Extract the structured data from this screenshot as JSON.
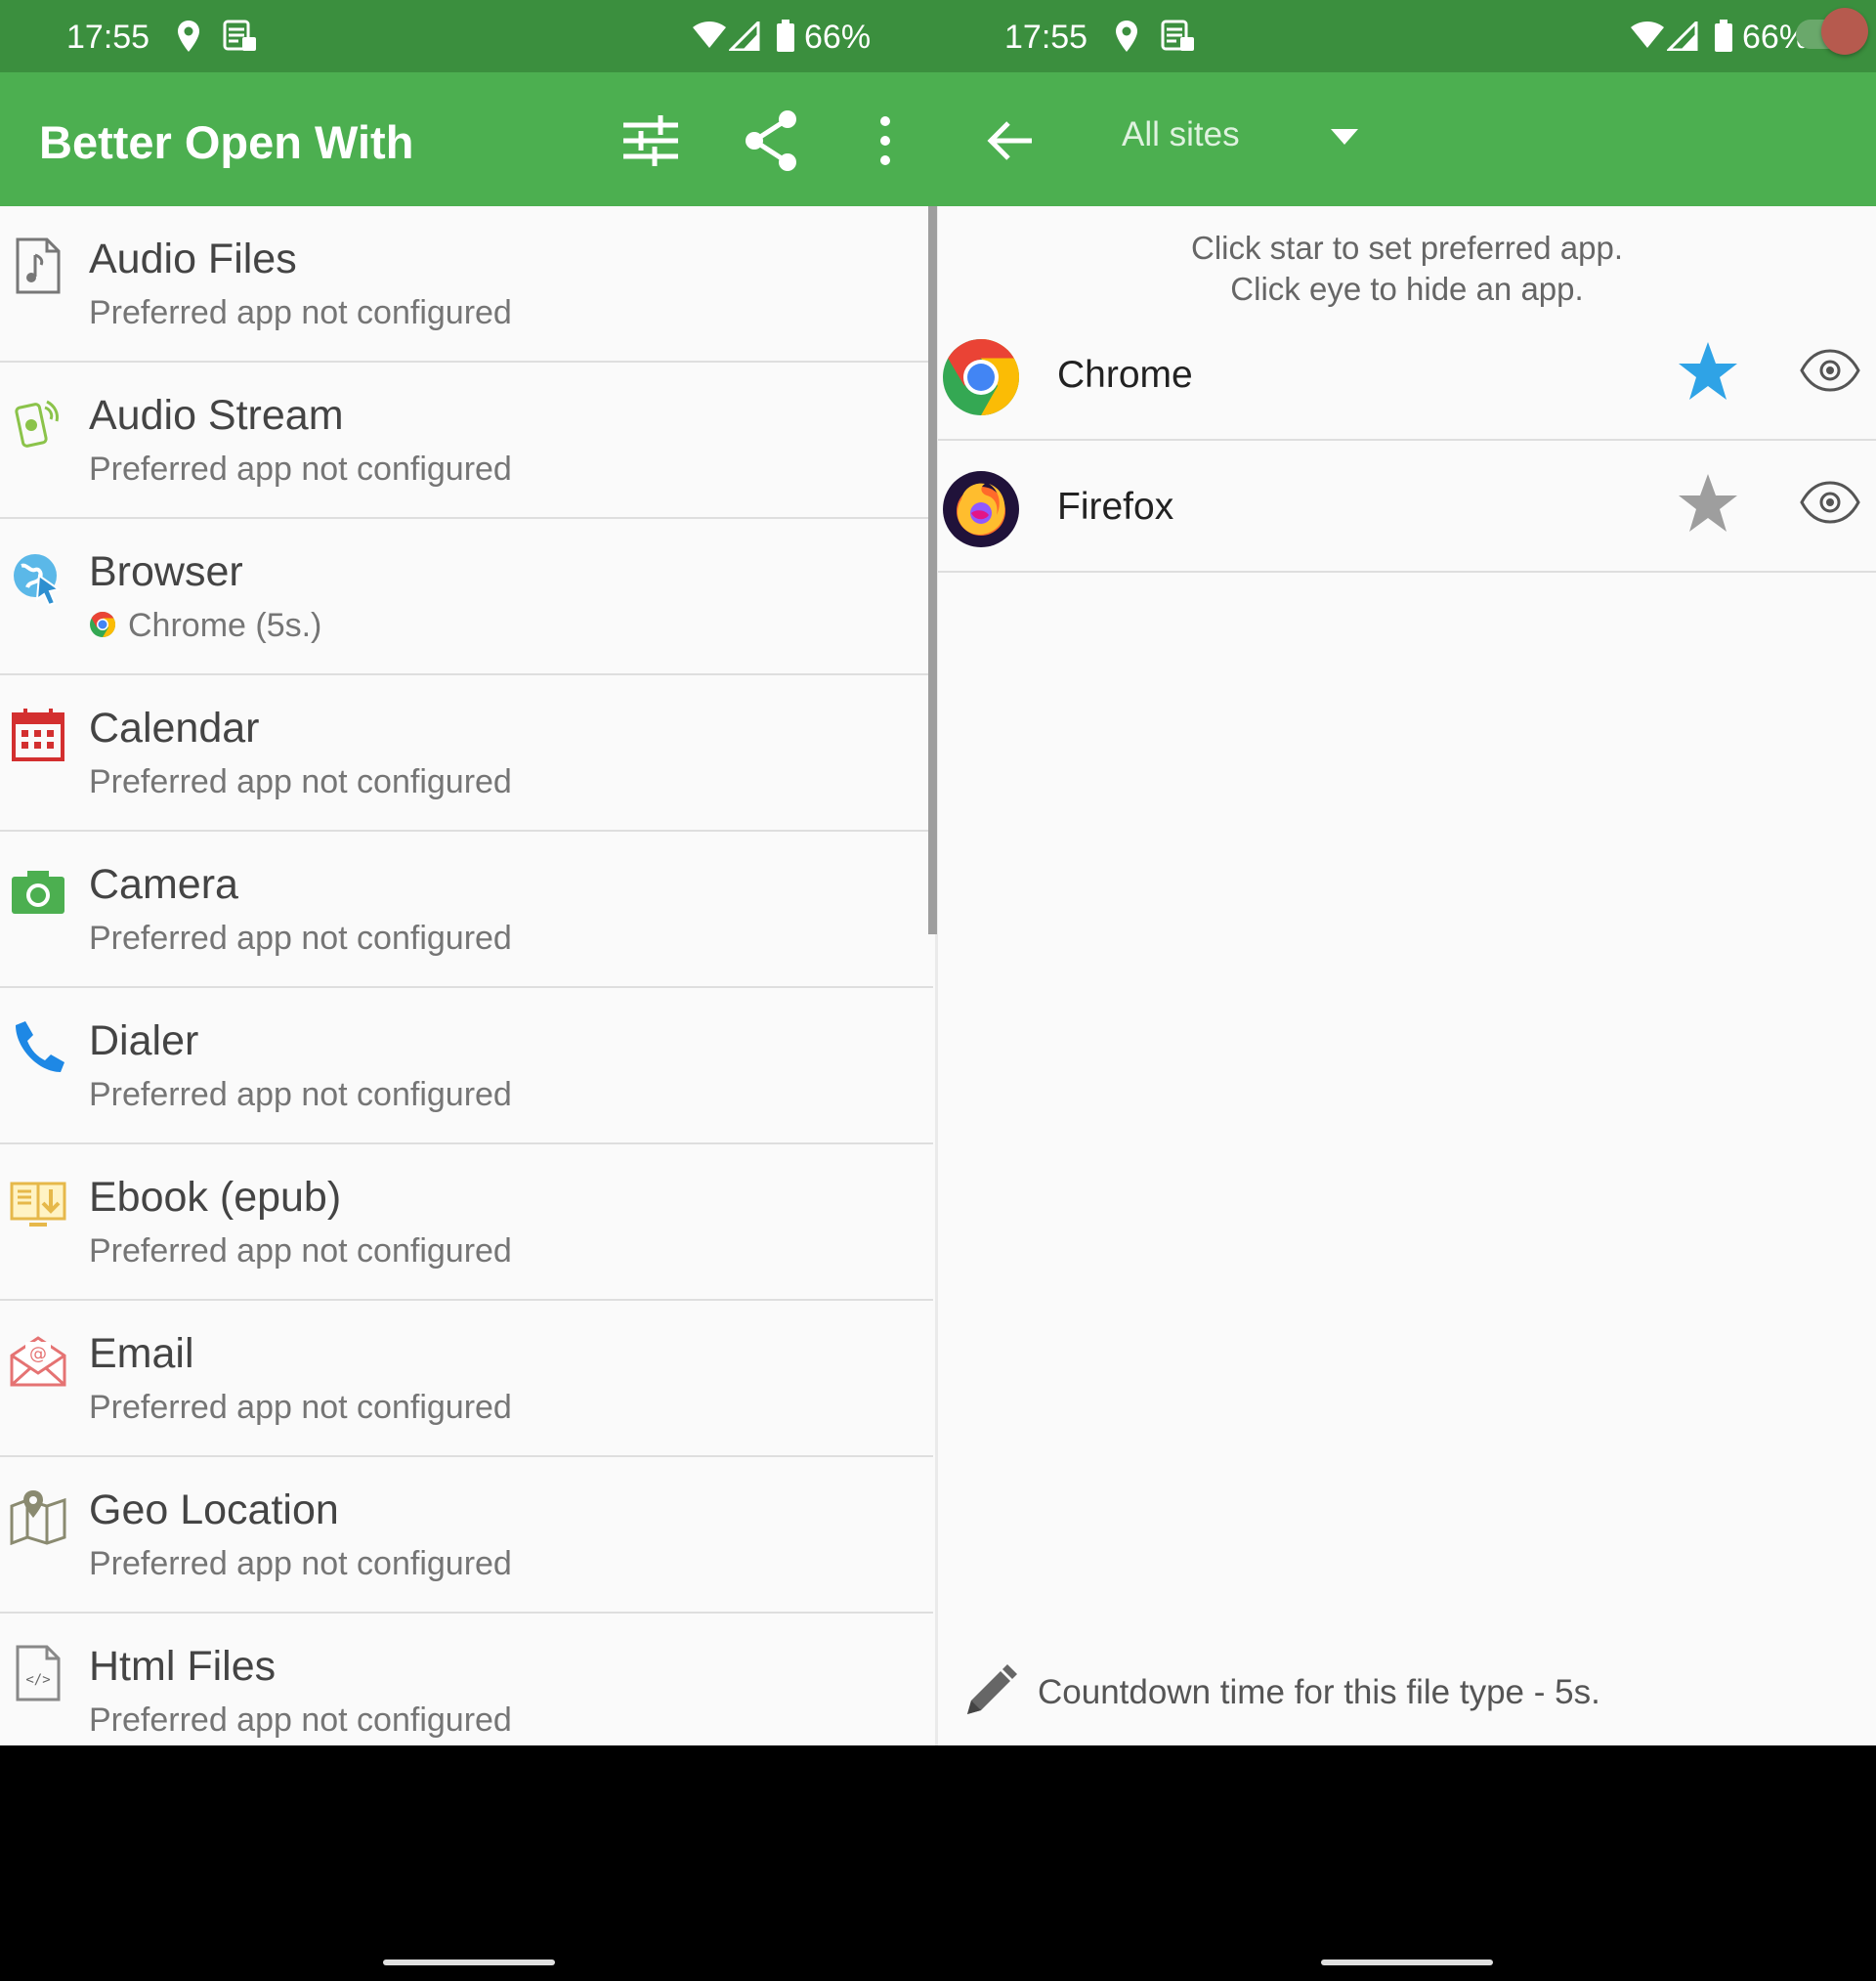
{
  "status_bar": {
    "time": "17:55",
    "battery": "66%",
    "icons": [
      "location-icon",
      "sim-data-icon",
      "wifi-icon",
      "signal-icon",
      "battery-icon"
    ]
  },
  "left": {
    "app_title": "Better Open With",
    "toolbar_icons": [
      "tune-icon",
      "share-icon",
      "more-vert-icon"
    ],
    "items": [
      {
        "title": "Audio Files",
        "subtitle": "Preferred app not configured",
        "icon": "audio-file-icon"
      },
      {
        "title": "Audio Stream",
        "subtitle": "Preferred app not configured",
        "icon": "audio-stream-icon"
      },
      {
        "title": "Browser",
        "subtitle": "Chrome (5s.)",
        "icon": "browser-globe-icon"
      },
      {
        "title": "Calendar",
        "subtitle": "Preferred app not configured",
        "icon": "calendar-icon"
      },
      {
        "title": "Camera",
        "subtitle": "Preferred app not configured",
        "icon": "camera-icon"
      },
      {
        "title": "Dialer",
        "subtitle": "Preferred app not configured",
        "icon": "phone-icon"
      },
      {
        "title": "Ebook (epub)",
        "subtitle": "Preferred app not configured",
        "icon": "ebook-icon"
      },
      {
        "title": "Email",
        "subtitle": "Preferred app not configured",
        "icon": "email-icon"
      },
      {
        "title": "Geo Location",
        "subtitle": "Preferred app not configured",
        "icon": "map-pin-icon"
      },
      {
        "title": "Html Files",
        "subtitle": "Preferred app not configured",
        "icon": "html-file-icon"
      }
    ]
  },
  "right": {
    "filter_label": "All sites",
    "hint_line1": "Click star to set preferred app.",
    "hint_line2": "Click eye to hide an app.",
    "apps": [
      {
        "name": "Chrome",
        "preferred": true
      },
      {
        "name": "Firefox",
        "preferred": false
      }
    ],
    "countdown_text": "Countdown time for this file type - 5s."
  },
  "colors": {
    "status_bar": "#3b8f3e",
    "app_bar": "#4caf50",
    "star_active": "#2fa3e6",
    "star_inactive": "#9e9e9e",
    "toggle_thumb": "#b65a4e"
  }
}
